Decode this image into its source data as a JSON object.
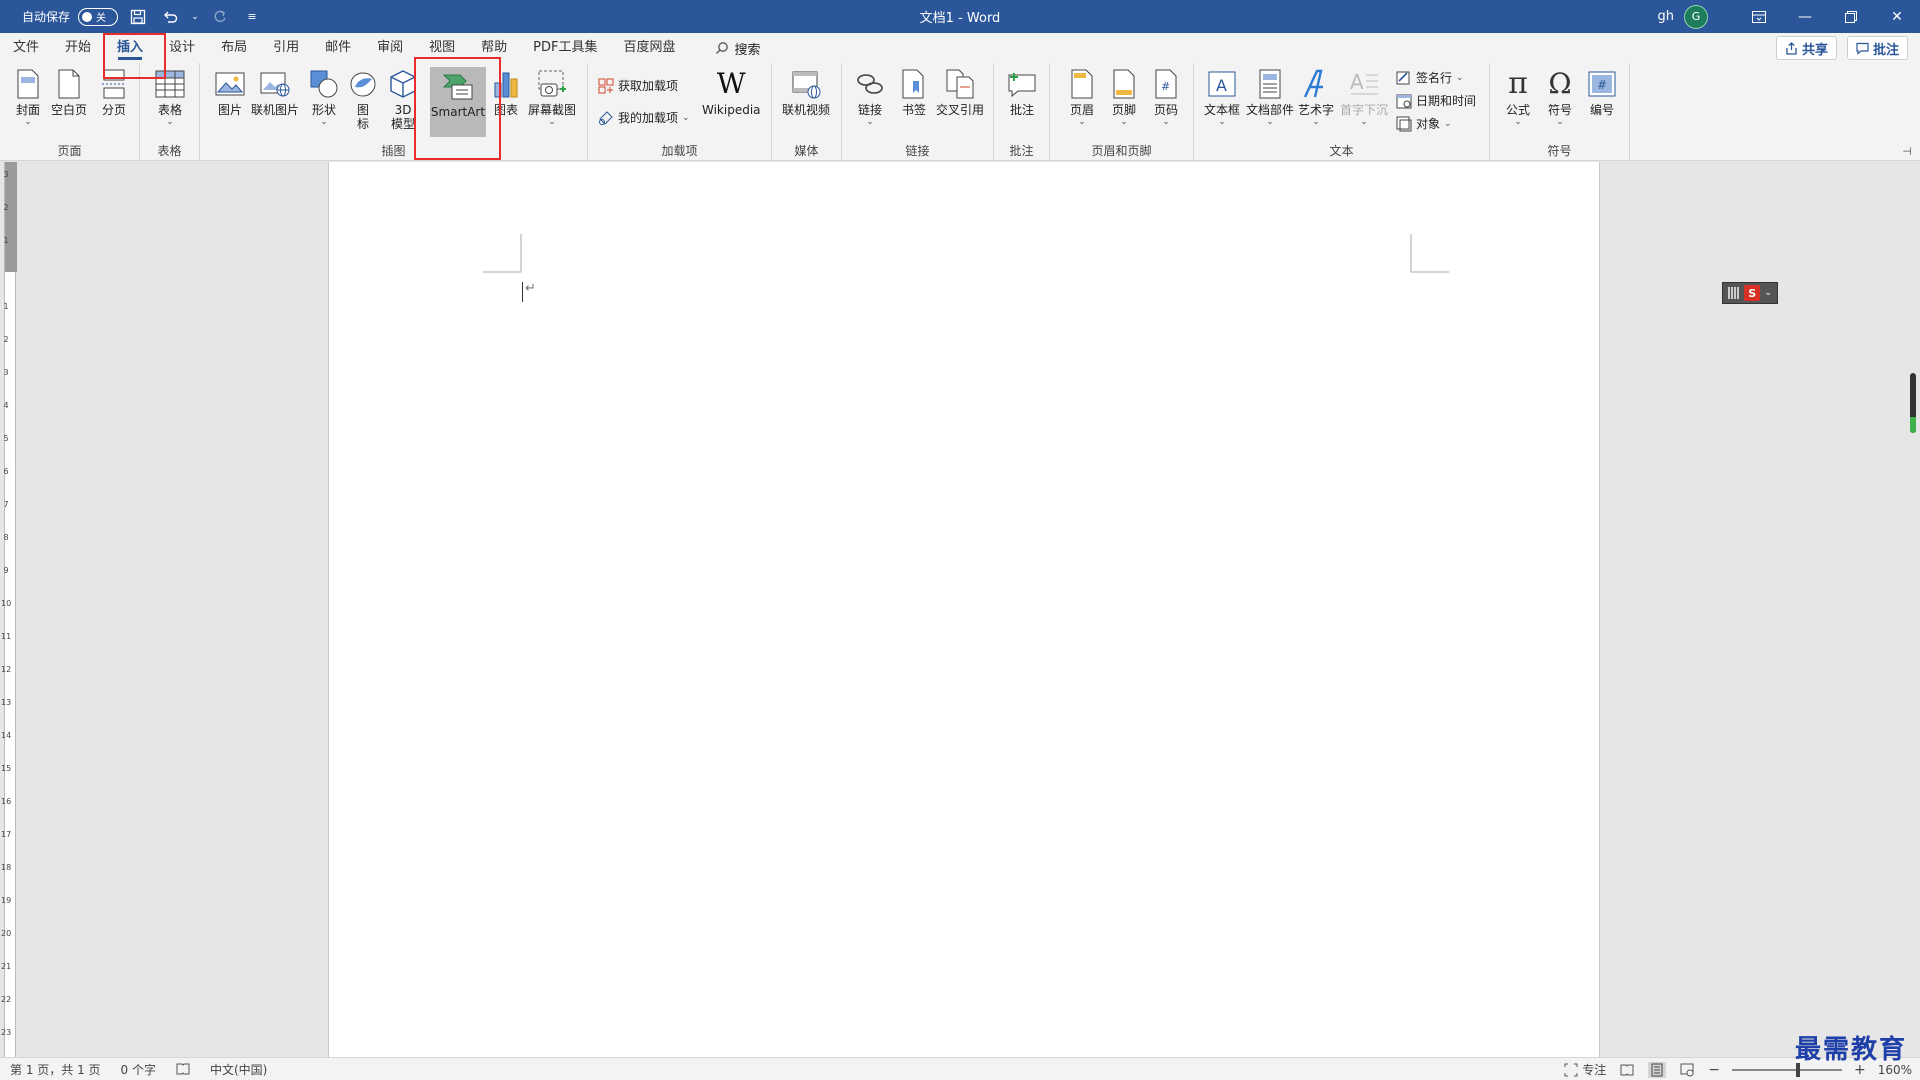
{
  "titlebar": {
    "autosave_label": "自动保存",
    "autosave_state": "关",
    "doc_title": "文档1 - Word",
    "user_name": "gh",
    "avatar_letter": "G"
  },
  "menu": {
    "tabs": [
      "文件",
      "开始",
      "插入",
      "设计",
      "布局",
      "引用",
      "邮件",
      "审阅",
      "视图",
      "帮助",
      "PDF工具集",
      "百度网盘"
    ],
    "active_tab": "插入",
    "search_label": "搜索",
    "share_label": "共享",
    "comment_label": "批注"
  },
  "ribbon": {
    "pages": {
      "label": "页面",
      "cover": "封面",
      "blank": "空白页",
      "break": "分页"
    },
    "tables": {
      "label": "表格",
      "table": "表格"
    },
    "illustrations": {
      "label": "插图",
      "picture": "图片",
      "online_picture": "联机图片",
      "shapes": "形状",
      "icons": "图标",
      "model3d": "3D 模型",
      "smartart": "SmartArt",
      "chart": "图表",
      "screenshot": "屏幕截图"
    },
    "addins": {
      "label": "加载项",
      "get": "获取加载项",
      "mine": "我的加载项",
      "wikipedia": "Wikipedia"
    },
    "media": {
      "label": "媒体",
      "online_video": "联机视频"
    },
    "links": {
      "label": "链接",
      "link": "链接",
      "bookmark": "书签",
      "cross_ref": "交叉引用"
    },
    "comments": {
      "label": "批注",
      "comment": "批注"
    },
    "header_footer": {
      "label": "页眉和页脚",
      "header": "页眉",
      "footer": "页脚",
      "page_number": "页码"
    },
    "text": {
      "label": "文本",
      "textbox": "文本框",
      "quick_parts": "文档部件",
      "wordart": "艺术字",
      "dropcap": "首字下沉",
      "signature": "签名行",
      "datetime": "日期和时间",
      "object": "对象"
    },
    "symbols": {
      "label": "符号",
      "equation": "公式",
      "symbol": "符号",
      "numbering": "编号"
    }
  },
  "statusbar": {
    "page": "第 1 页，共 1 页",
    "words": "0 个字",
    "language": "中文(中国)",
    "focus": "专注",
    "zoom": "160%"
  },
  "watermark": "最需教育",
  "colors": {
    "titlebar": "#2b579a",
    "highlight": "#ea2b2b",
    "smartart_selected": "#b9b9b9"
  }
}
